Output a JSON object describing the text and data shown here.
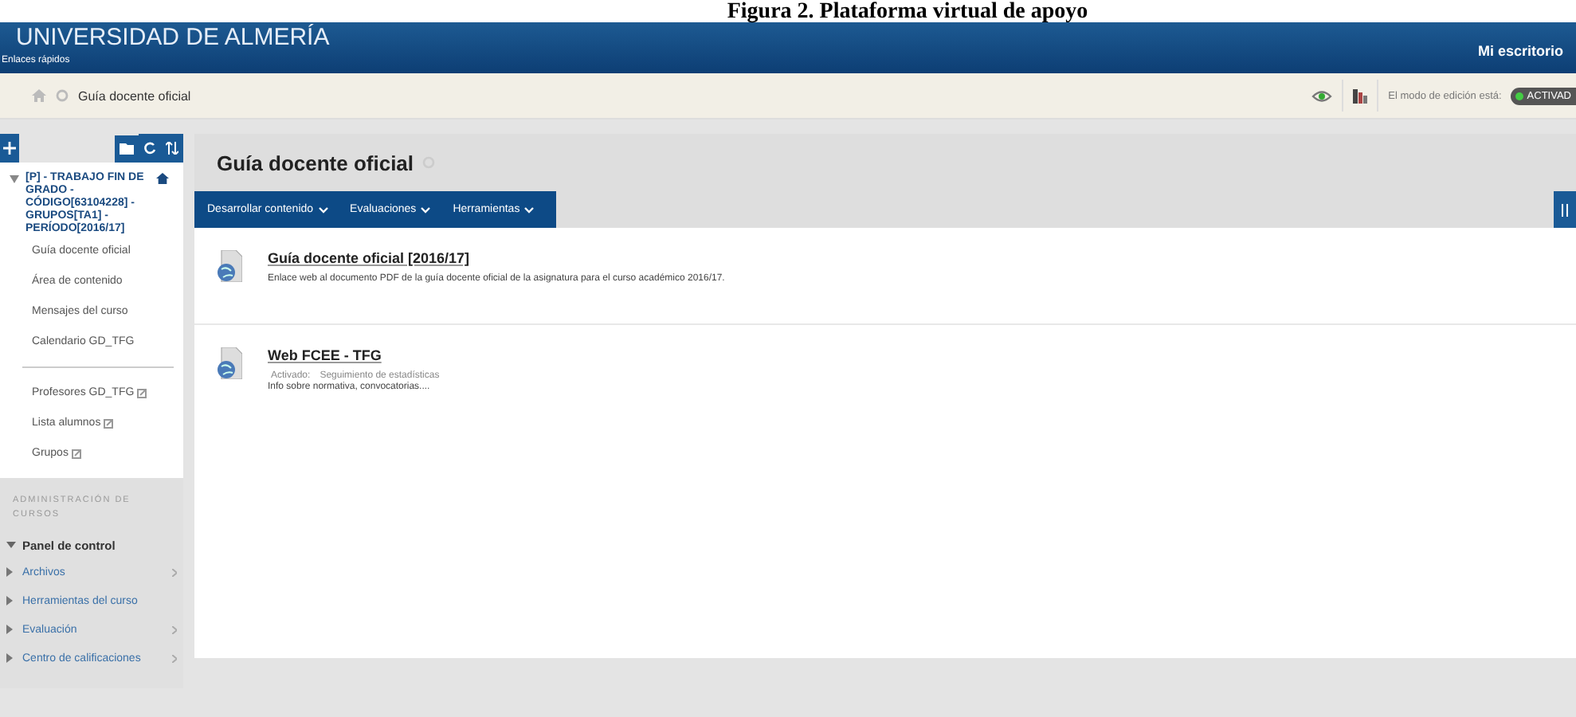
{
  "caption": "Figura 2. Plataforma virtual de apoyo",
  "header": {
    "title": "UNIVERSIDAD DE ALMERÍA",
    "quick_links": "Enlaces rápidos",
    "user_menu": "Mi escritorio"
  },
  "breadcrumb": {
    "items": [
      "Guía docente oficial"
    ]
  },
  "edit_mode": {
    "label": "El modo de edición está:",
    "status": "ACTIVAD",
    "on": true
  },
  "sidebar": {
    "course_title": "[P] - TRABAJO FIN DE GRADO - CÓDIGO[63104228] - GRUPOS[TA1] - PERÍODO[2016/17]",
    "items": [
      "Guía docente oficial",
      "Área de contenido",
      "Mensajes del curso",
      "Calendario GD_TFG"
    ],
    "links": [
      "Profesores GD_TFG",
      "Lista alumnos",
      "Grupos"
    ],
    "admin_heading": "ADMINISTRACIÓN DE CURSOS",
    "panel": {
      "label": "Panel de control",
      "expanded": true,
      "children": [
        {
          "label": "Archivos",
          "submenu": true
        },
        {
          "label": "Herramientas del curso",
          "submenu": false
        },
        {
          "label": "Evaluación",
          "submenu": true
        },
        {
          "label": "Centro de calificaciones",
          "submenu": true
        }
      ]
    }
  },
  "main": {
    "title": "Guía docente oficial",
    "actions": [
      "Desarrollar contenido",
      "Evaluaciones",
      "Herramientas"
    ],
    "items": [
      {
        "title": "Guía docente oficial [2016/17]",
        "description": "Enlace web al documento PDF de la guía docente oficial de la asignatura para el curso académico 2016/17."
      },
      {
        "title": "Web FCEE - TFG",
        "meta": [
          "Activado:",
          "Seguimiento de estadísticas"
        ],
        "description": "Info sobre normativa, convocatorias...."
      }
    ]
  }
}
